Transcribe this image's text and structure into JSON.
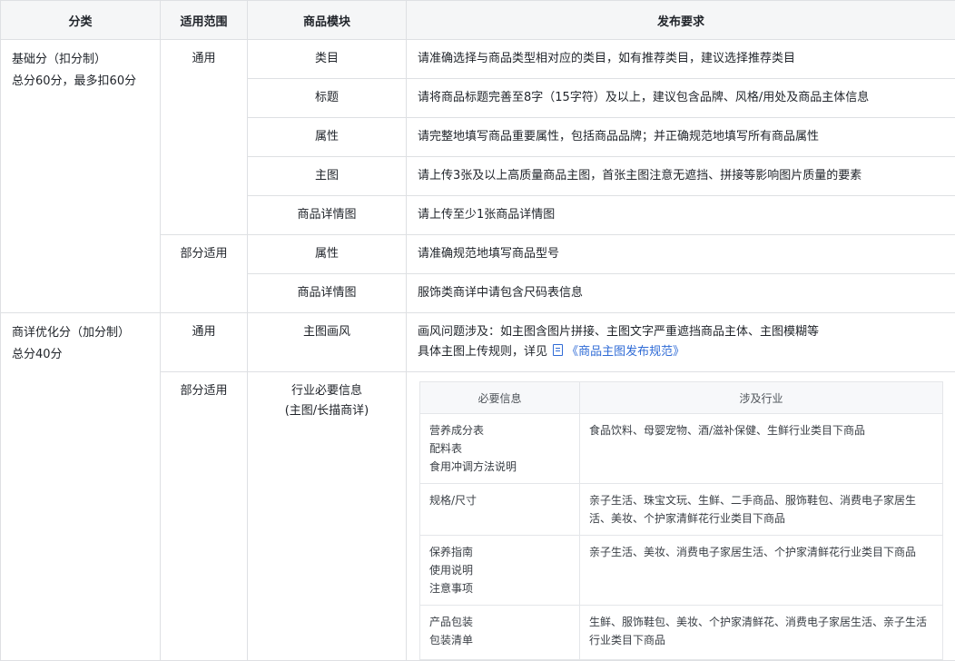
{
  "headers": [
    "分类",
    "适用范围",
    "商品模块",
    "发布要求"
  ],
  "basic": {
    "category": "基础分（扣分制）",
    "total": "总分60分，最多扣60分",
    "general_scope": "通用",
    "partial_scope": "部分适用",
    "rows": [
      {
        "module": "类目",
        "req": "请准确选择与商品类型相对应的类目，如有推荐类目，建议选择推荐类目"
      },
      {
        "module": "标题",
        "req": "请将商品标题完善至8字（15字符）及以上，建议包含品牌、风格/用处及商品主体信息"
      },
      {
        "module": "属性",
        "req": "请完整地填写商品重要属性，包括商品品牌；并正确规范地填写所有商品属性"
      },
      {
        "module": "主图",
        "req": "请上传3张及以上高质量商品主图，首张主图注意无遮挡、拼接等影响图片质量的要素"
      },
      {
        "module": "商品详情图",
        "req": "请上传至少1张商品详情图"
      },
      {
        "module": "属性",
        "req": "请准确规范地填写商品型号"
      },
      {
        "module": "商品详情图",
        "req": "服饰类商详中请包含尺码表信息"
      }
    ]
  },
  "optimize": {
    "category": "商详优化分（加分制）",
    "total": "总分40分",
    "general_scope": "通用",
    "partial_scope": "部分适用",
    "row1": {
      "module": "主图画风",
      "req_line1": "画风问题涉及：如主图含图片拼接、主图文字严重遮挡商品主体、主图模糊等",
      "req_line2_prefix": "具体主图上传规则，详见",
      "link_text": "《商品主图发布规范》"
    },
    "row2": {
      "module_line1": "行业必要信息",
      "module_line2": "(主图/长描商详)"
    },
    "inner": {
      "headers": [
        "必要信息",
        "涉及行业"
      ],
      "rows": [
        {
          "info": [
            "营养成分表",
            "配料表",
            "食用冲调方法说明"
          ],
          "industry": "食品饮料、母婴宠物、酒/滋补保健、生鲜行业类目下商品"
        },
        {
          "info": [
            "规格/尺寸"
          ],
          "industry": "亲子生活、珠宝文玩、生鲜、二手商品、服饰鞋包、消费电子家居生活、美妆、个护家清鲜花行业类目下商品"
        },
        {
          "info": [
            "保养指南",
            "使用说明",
            "注意事项"
          ],
          "industry": "亲子生活、美妆、消费电子家居生活、个护家清鲜花行业类目下商品"
        },
        {
          "info": [
            "产品包装",
            "包装清单"
          ],
          "industry": "生鲜、服饰鞋包、美妆、个护家清鲜花、消费电子家居生活、亲子生活行业类目下商品"
        }
      ]
    }
  }
}
